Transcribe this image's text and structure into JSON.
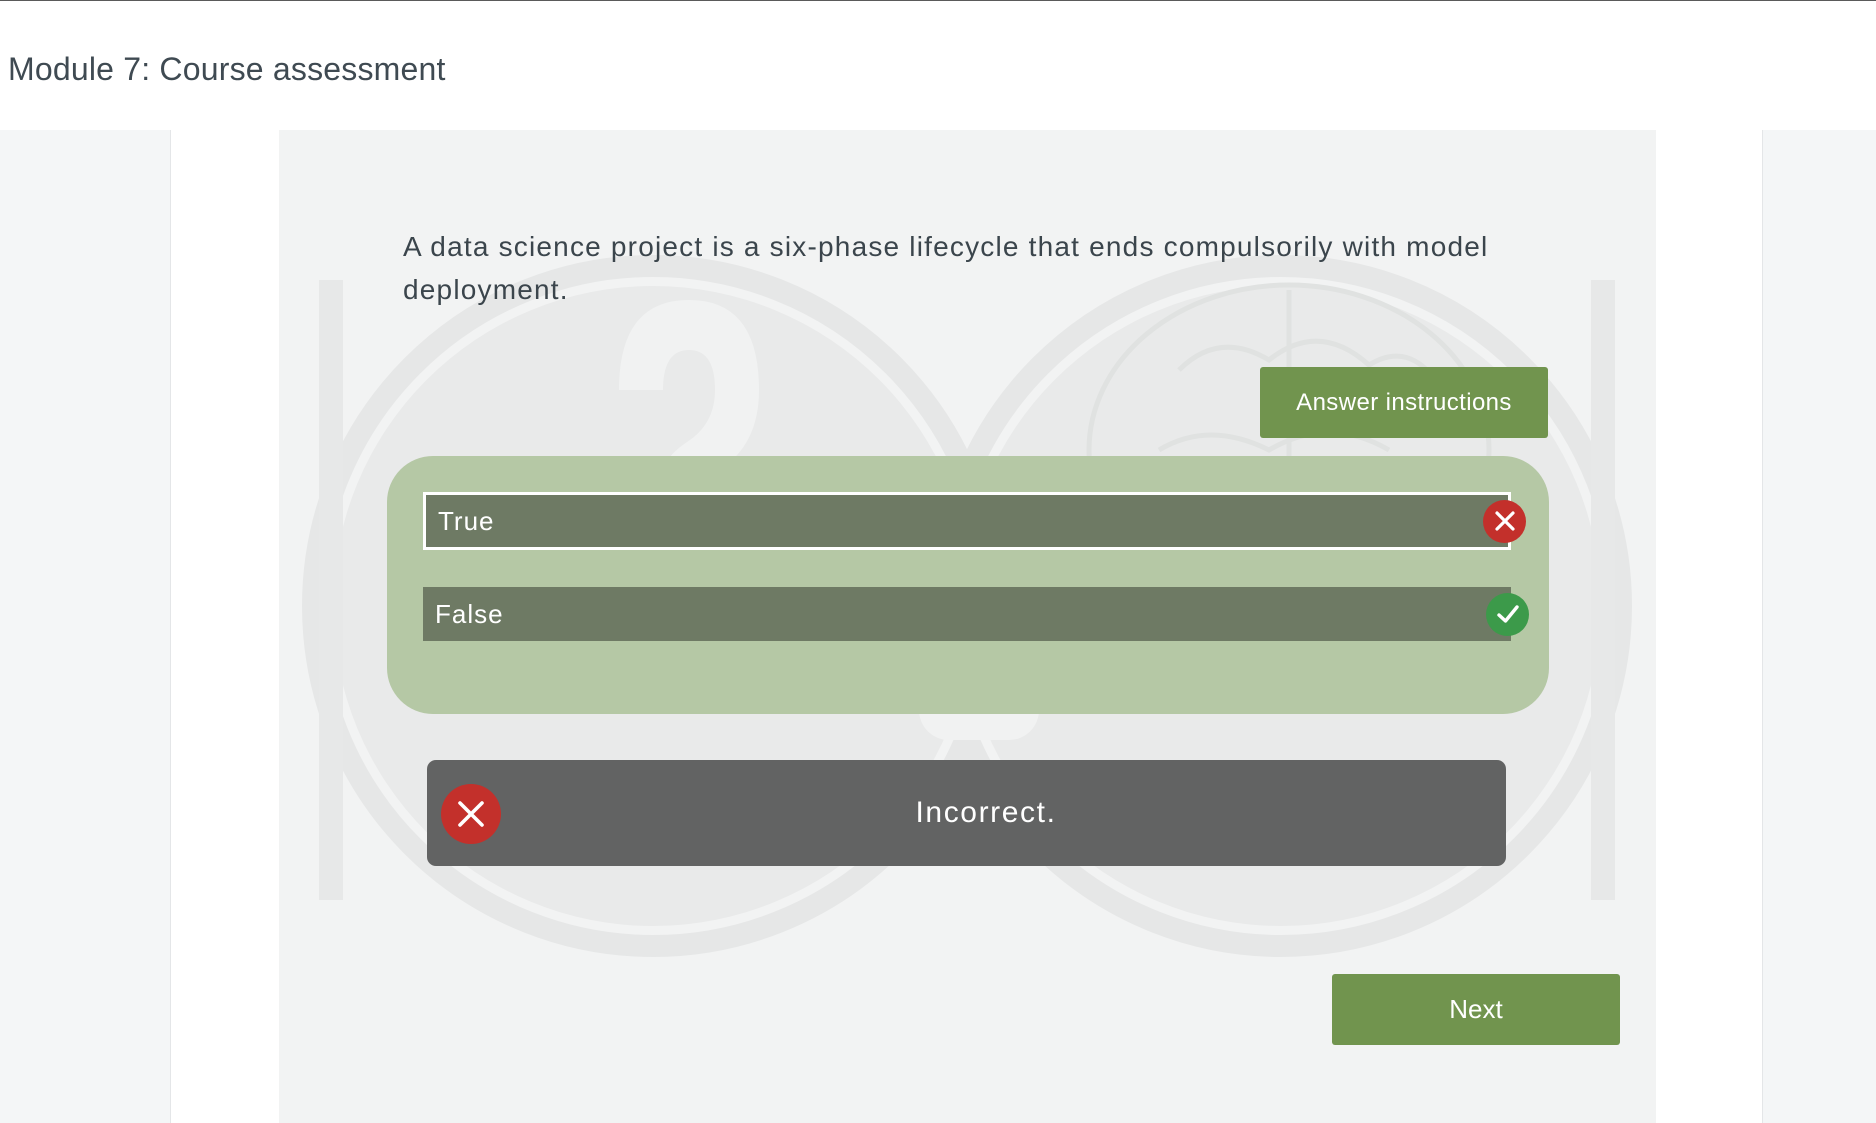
{
  "header": {
    "title": "Module 7: Course assessment"
  },
  "question": {
    "text": "A data science project is a six-phase lifecycle that ends compulsorily with model deployment."
  },
  "buttons": {
    "instructions_label": "Answer instructions",
    "next_label": "Next"
  },
  "options": [
    {
      "label": "True",
      "selected": true,
      "status_icon": "x-icon"
    },
    {
      "label": "False",
      "selected": false,
      "status_icon": "check-icon"
    }
  ],
  "feedback": {
    "text": "Incorrect.",
    "icon": "x-icon"
  },
  "colors": {
    "accent_green": "#71944e",
    "panel_green": "#b5c8a5",
    "option_bg": "#6e7a64",
    "incorrect_red": "#c3302b",
    "correct_green": "#3c9a4a",
    "feedback_bg": "#626363"
  }
}
